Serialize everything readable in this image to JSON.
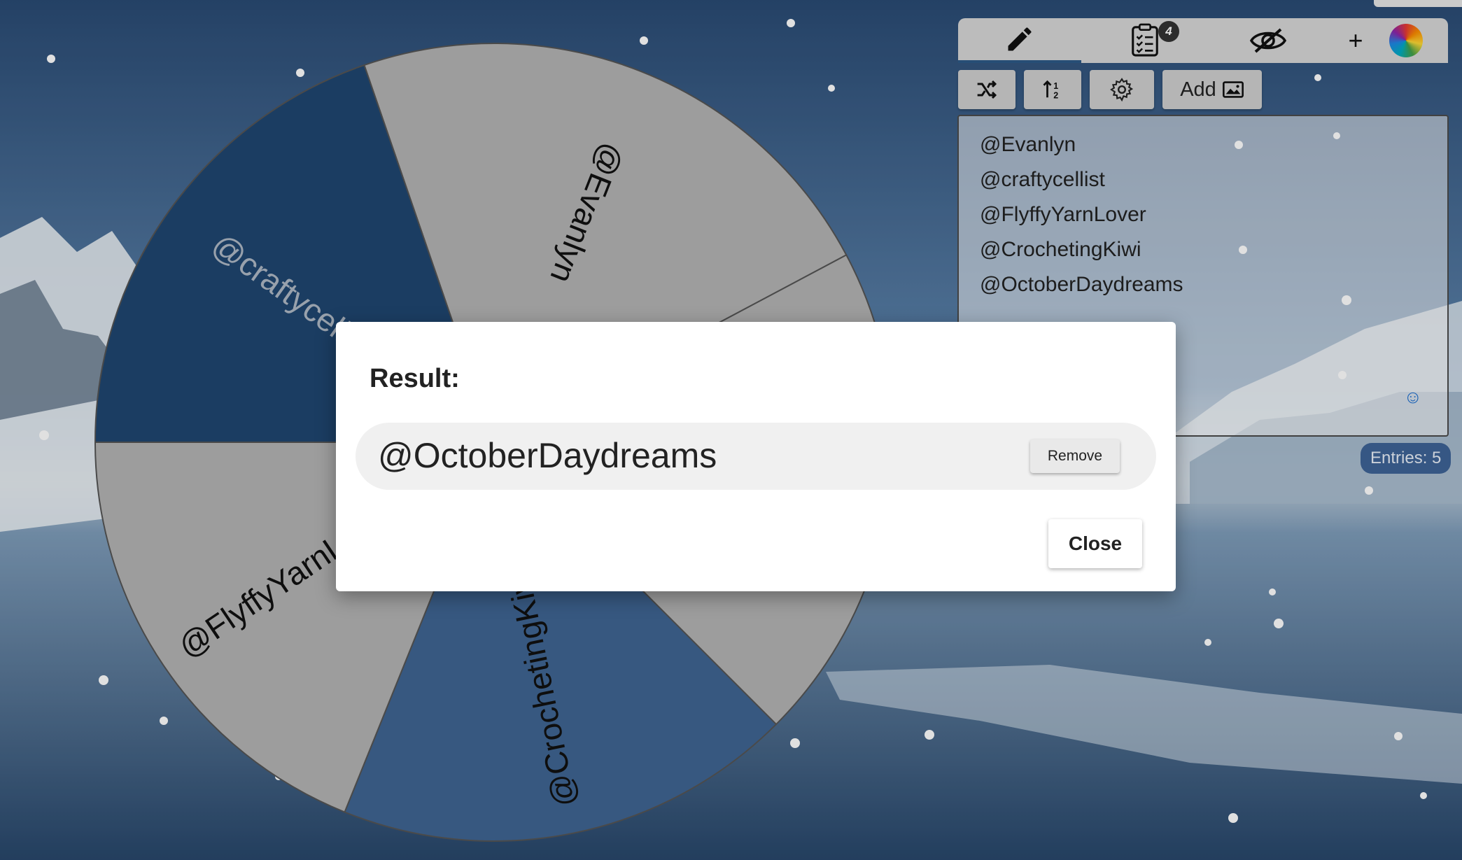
{
  "wheel": {
    "segments": [
      "@Evanlyn",
      "@craftycellist",
      "@FlyffyYarnLover",
      "@CrochetingKiwi",
      "@OctoberDaydreams"
    ],
    "colors": {
      "dark": "#1f4670",
      "mid": "#3f6592",
      "light": "#b3b3b3"
    }
  },
  "tabs": {
    "entries_icon": "pencil-icon",
    "results_icon": "clipboard-list-icon",
    "results_badge": "4",
    "hide_icon": "eye-off-icon",
    "add_label": "+",
    "theme_icon": "color-wheel-icon"
  },
  "toolbar": {
    "shuffle_icon": "shuffle-icon",
    "sort_icon": "sort-numeric-icon",
    "settings_icon": "gear-icon",
    "add_label": "Add",
    "add_image_icon": "image-icon"
  },
  "entries": {
    "lines": [
      "@Evanlyn",
      "@craftycellist",
      "@FlyffyYarnLover",
      "@CrochetingKiwi",
      "@OctoberDaydreams"
    ],
    "count_label": "Entries: 5"
  },
  "dialog": {
    "title": "Result:",
    "winner": "@OctoberDaydreams",
    "remove_label": "Remove",
    "close_label": "Close"
  }
}
